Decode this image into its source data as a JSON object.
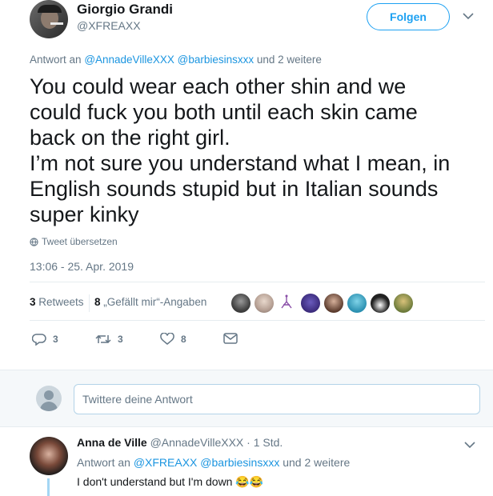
{
  "tweet": {
    "author_name": "Giorgio Grandi",
    "author_handle": "@XFREAXX",
    "follow_label": "Folgen",
    "reply_prefix": "Antwort an",
    "reply_to_1": "@AnnadeVilleXXX",
    "reply_to_2": "@barbiesinsxxx",
    "reply_suffix": "und 2 weitere",
    "text_lines": [
      "You could wear each other shin and we",
      "could fuck you both until each skin came",
      "back on the right girl.",
      "I’m not sure you understand what I mean, in",
      "English sounds stupid but in Italian sounds",
      "super kinky"
    ],
    "translate_label": "Tweet übersetzen",
    "timestamp": "13:06 - 25. Apr. 2019",
    "retweets_count": "3",
    "retweets_label": "Retweets",
    "likes_count": "8",
    "likes_label": "„Gefällt mir“-Angaben",
    "actions": {
      "reply_count": "3",
      "retweet_count": "3",
      "like_count": "8"
    }
  },
  "composer": {
    "placeholder": "Twittere deine Antwort"
  },
  "reply": {
    "author_name": "Anna de Ville",
    "author_handle": "@AnnadeVilleXXX",
    "time": "· 1 Std.",
    "reply_prefix": "Antwort an",
    "reply_to_1": "@XFREAXX",
    "reply_to_2": "@barbiesinsxxx",
    "reply_suffix": "und 2 weitere",
    "text": "I don't understand but I'm down",
    "emoji": "😂😂"
  },
  "colors": {
    "accent": "#1da1f2",
    "link": "#1b95e0",
    "muted": "#657786",
    "text": "#14171a"
  },
  "icons": [
    "chevron-down-icon",
    "globe-icon",
    "reply-icon",
    "retweet-icon",
    "heart-icon",
    "message-icon"
  ]
}
